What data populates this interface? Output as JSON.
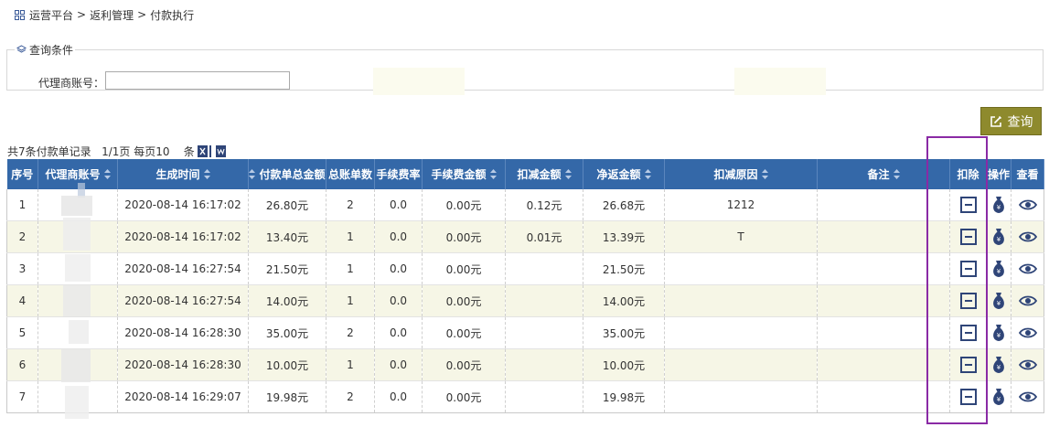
{
  "breadcrumb": {
    "home": "运营平台",
    "sep": ">",
    "section": "返利管理",
    "page": "付款执行"
  },
  "query": {
    "legend": "查询条件",
    "agent_label": "代理商账号：",
    "agent_value": "",
    "button_label": "查询"
  },
  "summary": {
    "text": "共7条付款单记录   1/1页 每页10    条"
  },
  "table": {
    "headers": [
      "序号",
      "代理商账号",
      "生成时间",
      "付款单总金额",
      "总账单数",
      "手续费率",
      "手续费金额",
      "扣减金额",
      "净返金额",
      "扣减原因",
      "备注",
      "扣除",
      "操作",
      "查看"
    ],
    "rows": [
      {
        "no": "1",
        "agent": "",
        "time": "2020-08-14 16:17:02",
        "total": "26.80元",
        "bills": "2",
        "rate": "0.0",
        "fee": "0.00元",
        "deduct": "0.12元",
        "net": "26.68元",
        "reason": "1212",
        "remark": ""
      },
      {
        "no": "2",
        "agent": "",
        "time": "2020-08-14 16:17:02",
        "total": "13.40元",
        "bills": "1",
        "rate": "0.0",
        "fee": "0.00元",
        "deduct": "0.01元",
        "net": "13.39元",
        "reason": "T",
        "remark": ""
      },
      {
        "no": "3",
        "agent": "",
        "time": "2020-08-14 16:27:54",
        "total": "21.50元",
        "bills": "1",
        "rate": "0.0",
        "fee": "0.00元",
        "deduct": "",
        "net": "21.50元",
        "reason": "",
        "remark": ""
      },
      {
        "no": "4",
        "agent": "",
        "time": "2020-08-14 16:27:54",
        "total": "14.00元",
        "bills": "1",
        "rate": "0.0",
        "fee": "0.00元",
        "deduct": "",
        "net": "14.00元",
        "reason": "",
        "remark": ""
      },
      {
        "no": "5",
        "agent": "",
        "time": "2020-08-14 16:28:30",
        "total": "35.00元",
        "bills": "2",
        "rate": "0.0",
        "fee": "0.00元",
        "deduct": "",
        "net": "35.00元",
        "reason": "",
        "remark": ""
      },
      {
        "no": "6",
        "agent": "",
        "time": "2020-08-14 16:28:30",
        "total": "10.00元",
        "bills": "1",
        "rate": "0.0",
        "fee": "0.00元",
        "deduct": "",
        "net": "10.00元",
        "reason": "",
        "remark": ""
      },
      {
        "no": "7",
        "agent": "",
        "time": "2020-08-14 16:29:07",
        "total": "19.98元",
        "bills": "2",
        "rate": "0.0",
        "fee": "0.00元",
        "deduct": "",
        "net": "19.98元",
        "reason": "",
        "remark": ""
      }
    ]
  },
  "icons": {
    "breadcrumb": "grid-icon",
    "legend": "layers-icon",
    "query_button": "edit-icon",
    "export_excel": "excel-icon",
    "export_word": "word-icon",
    "sort": "sort-icon",
    "deduct": "minus-square-icon",
    "operate": "money-bag-icon",
    "view": "eye-icon"
  },
  "colors": {
    "header_bg": "#3468a8",
    "query_button": "#8e8a2d",
    "row_alt": "#f6f6e6",
    "icon_navy": "#2f4578",
    "highlight": "#8a2aa5"
  }
}
